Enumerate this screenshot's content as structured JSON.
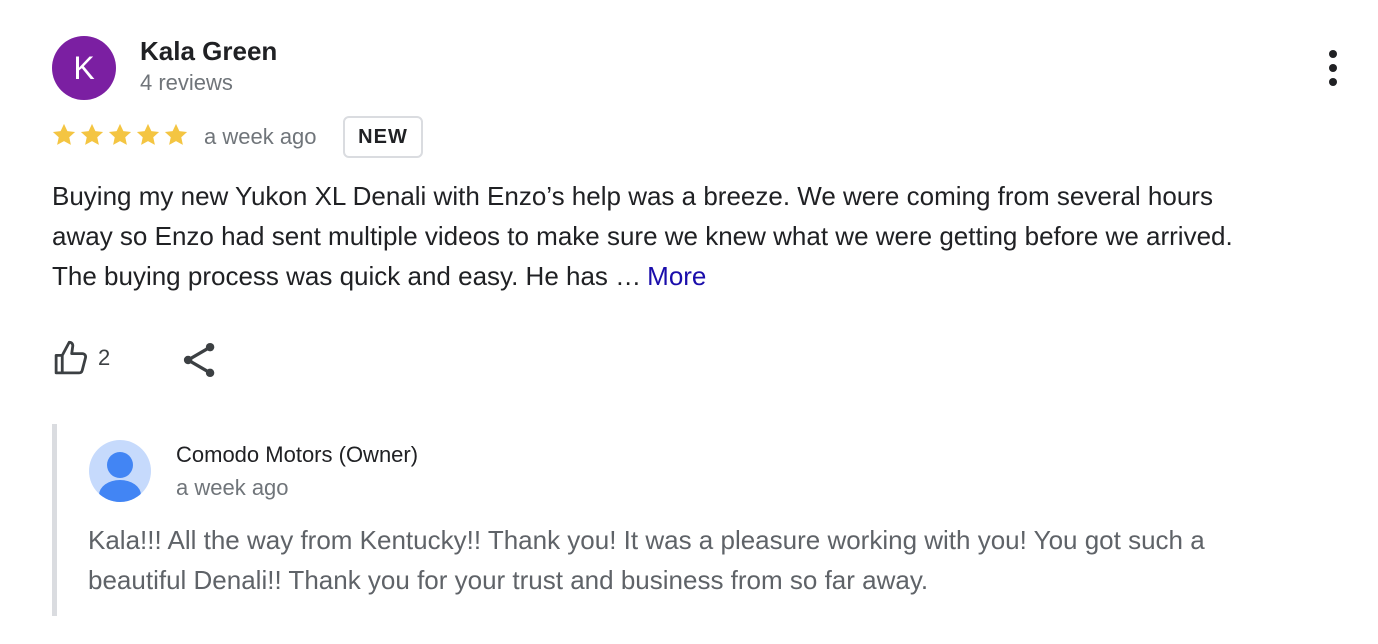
{
  "review": {
    "avatar_letter": "K",
    "avatar_color": "#7b1fa2",
    "reviewer_name": "Kala Green",
    "review_count": "4 reviews",
    "rating": 5,
    "rating_max": 5,
    "star_color": "#f4c542",
    "time": "a week ago",
    "badge": "NEW",
    "text_lines": [
      "Buying my new Yukon XL Denali with Enzo’s help was a breeze. We were coming from several hours",
      "away so Enzo had sent multiple videos to make sure we knew what we were getting before we arrived.",
      "The buying process was quick and easy. He has …"
    ],
    "more_label": "More",
    "like_count": "2",
    "icons": {
      "menu": "more-vert-icon",
      "like": "thumb-up-icon",
      "share": "share-icon"
    }
  },
  "owner_response": {
    "name": "Comodo Motors (Owner)",
    "time": "a week ago",
    "avatar_color": "#4285f4",
    "text_lines": [
      "Kala!!! All the way from Kentucky!! Thank you! It was a pleasure working with you! You got such a",
      "beautiful Denali!! Thank you for your trust and business from so far away."
    ]
  }
}
